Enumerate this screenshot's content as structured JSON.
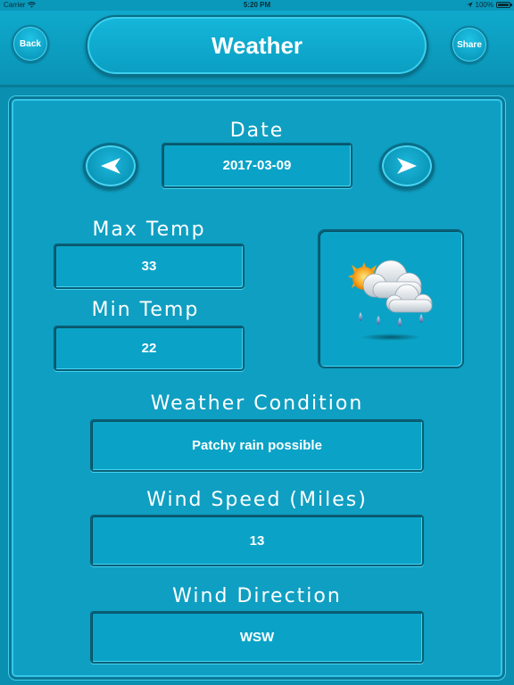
{
  "status_bar": {
    "carrier": "Carrier",
    "time": "5:20 PM",
    "battery": "100%"
  },
  "header": {
    "back_label": "Back",
    "title": "Weather",
    "share_label": "Share"
  },
  "date": {
    "label": "Date",
    "value": "2017-03-09"
  },
  "max_temp": {
    "label": "Max Temp",
    "value": "33"
  },
  "min_temp": {
    "label": "Min Temp",
    "value": "22"
  },
  "condition": {
    "label": "Weather Condition",
    "value": "Patchy rain possible",
    "icon": "sun-cloud-rain-icon"
  },
  "wind_speed": {
    "label": "Wind Speed (Miles)",
    "value": "13"
  },
  "wind_direction": {
    "label": "Wind Direction",
    "value": "WSW"
  }
}
